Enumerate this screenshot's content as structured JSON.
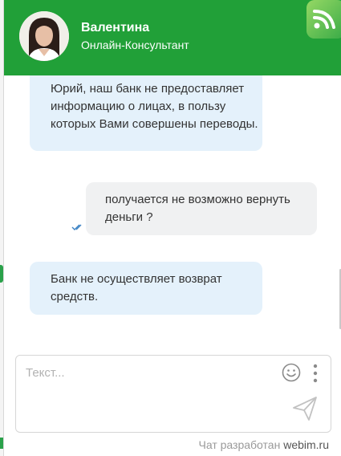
{
  "agent": {
    "name": "Валентина",
    "role": "Онлайн-Консультант"
  },
  "messages": [
    {
      "from": "operator",
      "text": "Юрий, наш банк не предоставляет информацию о лицах, в пользу которых Вами совершены переводы."
    },
    {
      "from": "visitor",
      "text": "получается не возможно вернуть деньги ?",
      "status_icon": "double-check-icon"
    },
    {
      "from": "operator",
      "text": "Банк не осуществляет возврат средств."
    }
  ],
  "composer": {
    "placeholder": "Текст..."
  },
  "footer": {
    "prefix": "Чат разработан",
    "brand": "webim.ru"
  },
  "colors": {
    "header": "#21a038",
    "operator_bubble": "#e4f1fb",
    "visitor_bubble": "#f0f1f2",
    "check_icon": "#3b82c4"
  },
  "icons": [
    "logo-icon",
    "smile-icon",
    "more-vertical-icon",
    "send-icon",
    "double-check-icon"
  ]
}
